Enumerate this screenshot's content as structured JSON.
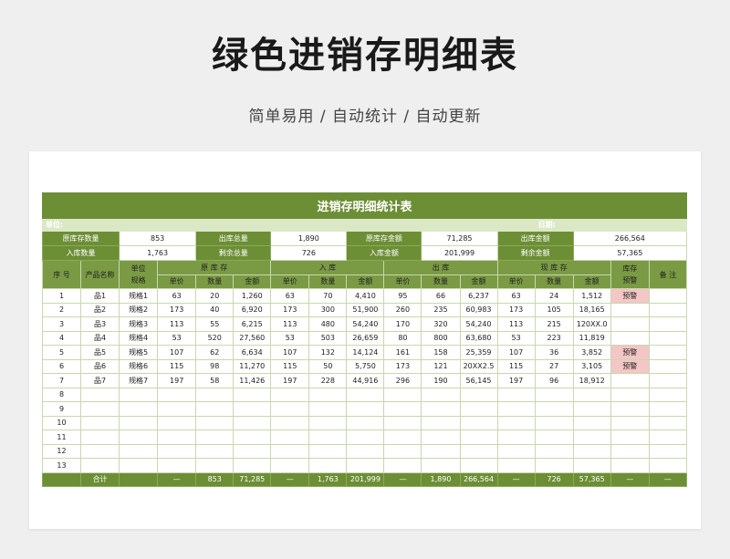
{
  "page": {
    "title": "绿色进销存明细表",
    "subtitle": "简单易用  /  自动统计  /  自动更新"
  },
  "sheet": {
    "title": "进销存明细统计表",
    "unit_label": "单位:",
    "date_label": "日期:",
    "summary": [
      [
        {
          "label": "原库存数量",
          "value": "853"
        },
        {
          "label": "出库总量",
          "value": "1,890"
        },
        {
          "label": "原库存金额",
          "value": "71,285"
        },
        {
          "label": "出库金额",
          "value": "266,564"
        }
      ],
      [
        {
          "label": "入库数量",
          "value": "1,763"
        },
        {
          "label": "剩余总量",
          "value": "726"
        },
        {
          "label": "入库金额",
          "value": "201,999"
        },
        {
          "label": "剩余金额",
          "value": "57,365"
        }
      ]
    ],
    "headers": {
      "seq": "序  号",
      "product": "产品名称",
      "unit_spec": "单位\n规格",
      "group_original": "原 库 存",
      "group_in": "入   库",
      "group_out": "出   库",
      "group_current": "现 库 存",
      "stock_warning": "库存\n预警",
      "remark": "备    注",
      "unit_price": "单价",
      "quantity": "数量",
      "amount": "金额"
    },
    "rows": [
      {
        "no": "1",
        "name": "品1",
        "spec": "规格1",
        "o_price": "63",
        "o_qty": "20",
        "o_amt": "1,260",
        "i_price": "63",
        "i_qty": "70",
        "i_amt": "4,410",
        "s_price": "95",
        "s_qty": "66",
        "s_amt": "6,237",
        "c_price": "63",
        "c_qty": "24",
        "c_amt": "1,512",
        "warn": "预警",
        "remark": ""
      },
      {
        "no": "2",
        "name": "品2",
        "spec": "规格2",
        "o_price": "173",
        "o_qty": "40",
        "o_amt": "6,920",
        "i_price": "173",
        "i_qty": "300",
        "i_amt": "51,900",
        "s_price": "260",
        "s_qty": "235",
        "s_amt": "60,983",
        "c_price": "173",
        "c_qty": "105",
        "c_amt": "18,165",
        "warn": "",
        "remark": ""
      },
      {
        "no": "3",
        "name": "品3",
        "spec": "规格3",
        "o_price": "113",
        "o_qty": "55",
        "o_amt": "6,215",
        "i_price": "113",
        "i_qty": "480",
        "i_amt": "54,240",
        "s_price": "170",
        "s_qty": "320",
        "s_amt": "54,240",
        "c_price": "113",
        "c_qty": "215",
        "c_amt": "120XX.0",
        "warn": "",
        "remark": ""
      },
      {
        "no": "4",
        "name": "品4",
        "spec": "规格4",
        "o_price": "53",
        "o_qty": "520",
        "o_amt": "27,560",
        "i_price": "53",
        "i_qty": "503",
        "i_amt": "26,659",
        "s_price": "80",
        "s_qty": "800",
        "s_amt": "63,680",
        "c_price": "53",
        "c_qty": "223",
        "c_amt": "11,819",
        "warn": "",
        "remark": ""
      },
      {
        "no": "5",
        "name": "品5",
        "spec": "规格5",
        "o_price": "107",
        "o_qty": "62",
        "o_amt": "6,634",
        "i_price": "107",
        "i_qty": "132",
        "i_amt": "14,124",
        "s_price": "161",
        "s_qty": "158",
        "s_amt": "25,359",
        "c_price": "107",
        "c_qty": "36",
        "c_amt": "3,852",
        "warn": "预警",
        "remark": ""
      },
      {
        "no": "6",
        "name": "品6",
        "spec": "规格6",
        "o_price": "115",
        "o_qty": "98",
        "o_amt": "11,270",
        "i_price": "115",
        "i_qty": "50",
        "i_amt": "5,750",
        "s_price": "173",
        "s_qty": "121",
        "s_amt": "20XX2.5",
        "c_price": "115",
        "c_qty": "27",
        "c_amt": "3,105",
        "warn": "预警",
        "remark": ""
      },
      {
        "no": "7",
        "name": "品7",
        "spec": "规格7",
        "o_price": "197",
        "o_qty": "58",
        "o_amt": "11,426",
        "i_price": "197",
        "i_qty": "228",
        "i_amt": "44,916",
        "s_price": "296",
        "s_qty": "190",
        "s_amt": "56,145",
        "c_price": "197",
        "c_qty": "96",
        "c_amt": "18,912",
        "warn": "",
        "remark": ""
      },
      {
        "no": "8"
      },
      {
        "no": "9"
      },
      {
        "no": "10"
      },
      {
        "no": "11"
      },
      {
        "no": "12"
      },
      {
        "no": "13"
      }
    ],
    "total": {
      "label": "合计",
      "o_price": "—",
      "o_qty": "853",
      "o_amt": "71,285",
      "i_price": "—",
      "i_qty": "1,763",
      "i_amt": "201,999",
      "s_price": "—",
      "s_qty": "1,890",
      "s_amt": "266,564",
      "c_price": "—",
      "c_qty": "726",
      "c_amt": "57,365",
      "warn": "—",
      "remark": "—"
    }
  }
}
